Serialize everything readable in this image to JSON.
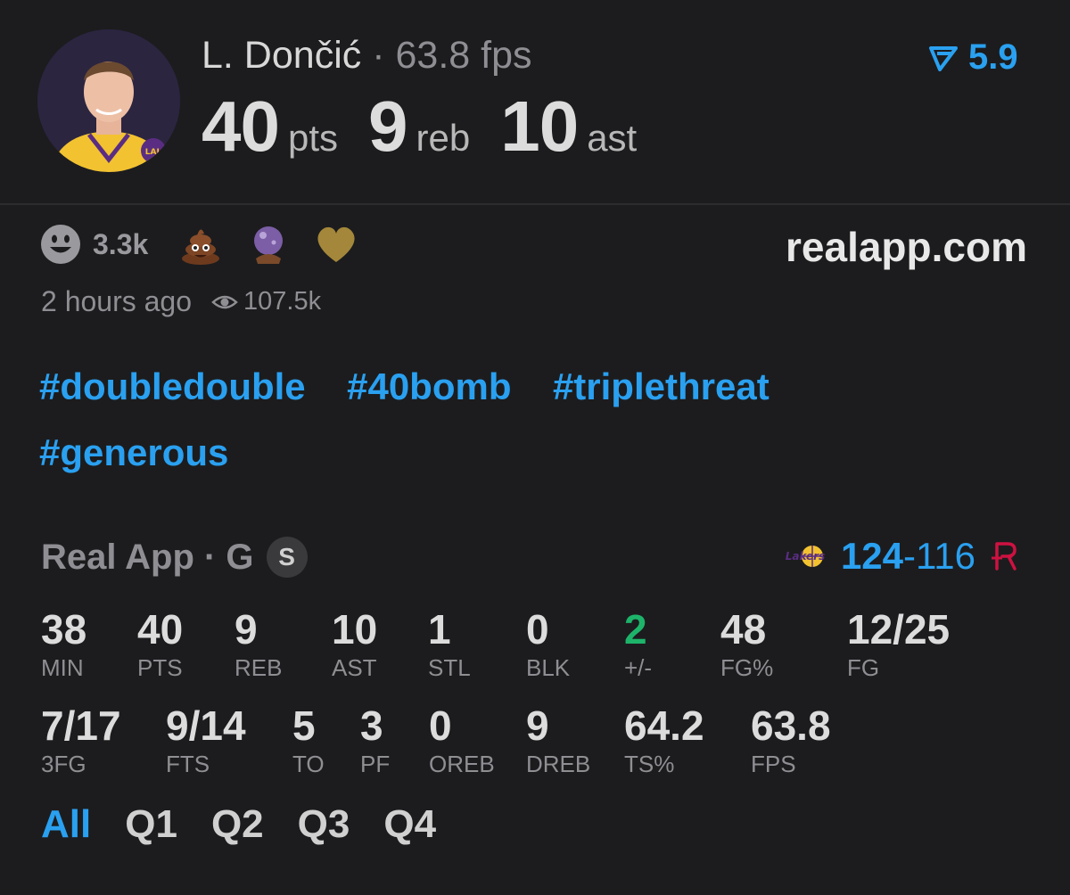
{
  "header": {
    "player_name": "L. Dončić",
    "separator": "·",
    "fps": "63.8 fps",
    "rating": "5.9",
    "stats": [
      {
        "value": "40",
        "unit": "pts"
      },
      {
        "value": "9",
        "unit": "reb"
      },
      {
        "value": "10",
        "unit": "ast"
      }
    ]
  },
  "reactions": {
    "smile_count": "3.3k",
    "icons": [
      "smile-emoji-icon",
      "poop-emoji-icon",
      "crystal-ball-emoji-icon",
      "gold-heart-icon"
    ]
  },
  "site": "realapp.com",
  "meta": {
    "time": "2 hours ago",
    "views": "107.5k"
  },
  "hashtags": [
    "#doubledouble",
    "#40bomb",
    "#triplethreat",
    "#generous"
  ],
  "game": {
    "source": "Real App · G",
    "badge": "S",
    "score_home": "124",
    "score_dash": "-",
    "score_away": "116"
  },
  "box_row1": [
    {
      "value": "38",
      "label": "MIN"
    },
    {
      "value": "40",
      "label": "PTS"
    },
    {
      "value": "9",
      "label": "REB"
    },
    {
      "value": "10",
      "label": "AST"
    },
    {
      "value": "1",
      "label": "STL"
    },
    {
      "value": "0",
      "label": "BLK"
    },
    {
      "value": "2",
      "label": "+/-"
    },
    {
      "value": "48",
      "label": "FG%"
    },
    {
      "value": "12/25",
      "label": "FG"
    }
  ],
  "box_row2": [
    {
      "value": "7/17",
      "label": "3FG"
    },
    {
      "value": "9/14",
      "label": "FTS"
    },
    {
      "value": "5",
      "label": "TO"
    },
    {
      "value": "3",
      "label": "PF"
    },
    {
      "value": "0",
      "label": "OREB"
    },
    {
      "value": "9",
      "label": "DREB"
    },
    {
      "value": "64.2",
      "label": "TS%"
    },
    {
      "value": "63.8",
      "label": "FPS"
    }
  ],
  "tabs": [
    "All",
    "Q1",
    "Q2",
    "Q3",
    "Q4"
  ],
  "colors": {
    "accent": "#2aa0f0",
    "positive": "#1db46a",
    "background": "#1c1c1e"
  }
}
